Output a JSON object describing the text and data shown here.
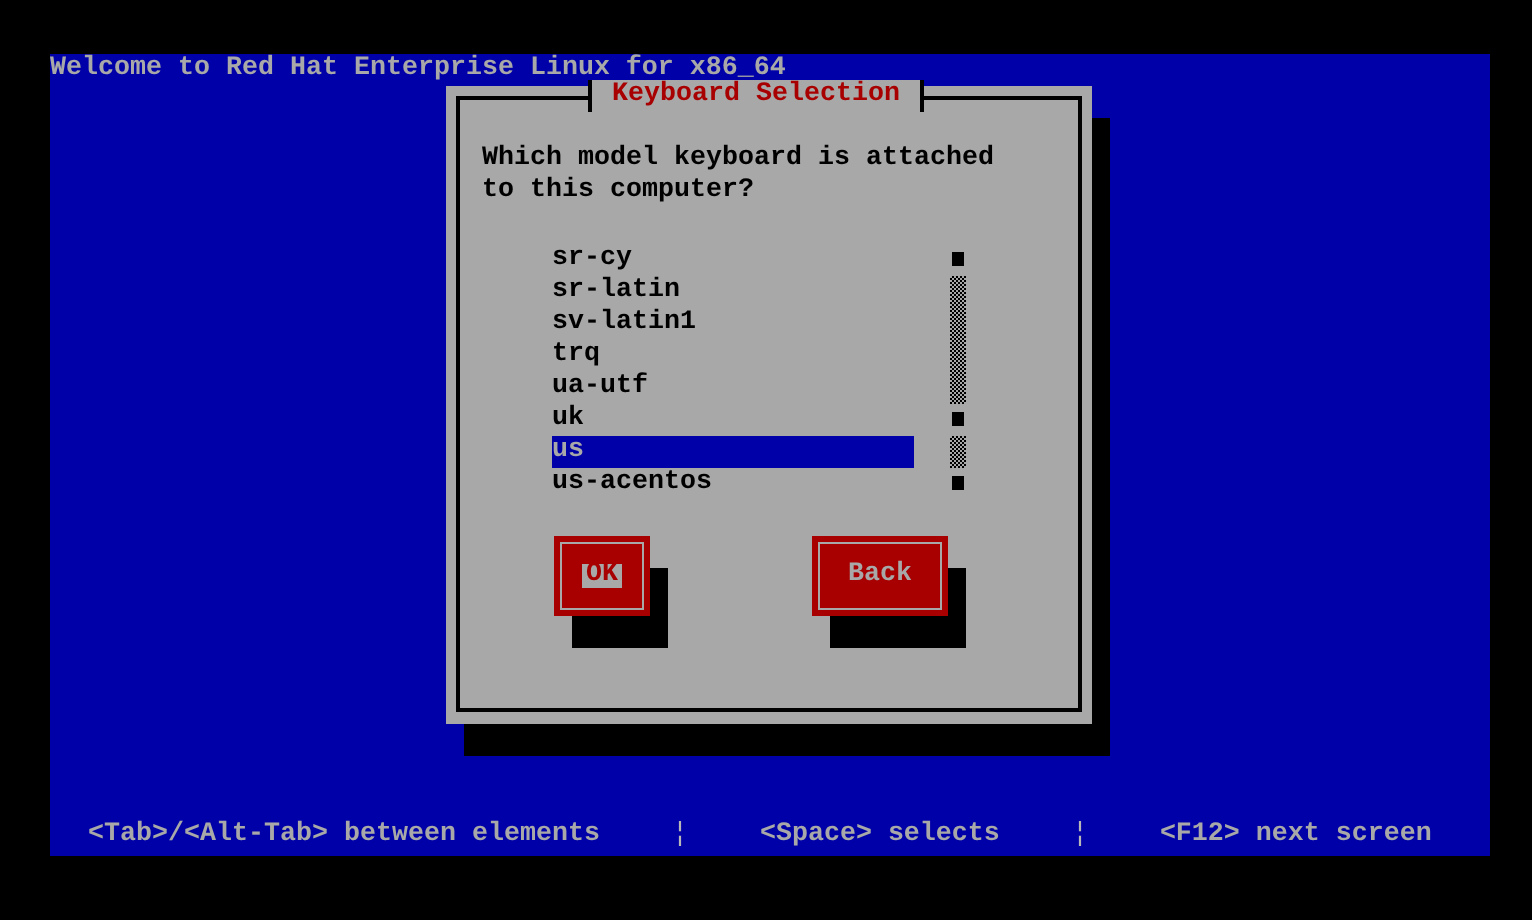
{
  "screen": {
    "title": "Welcome to Red Hat Enterprise Linux for x86_64"
  },
  "dialog": {
    "title": "Keyboard Selection",
    "prompt": "Which model keyboard is attached to this computer?",
    "items": [
      {
        "label": "sr-cy",
        "selected": false
      },
      {
        "label": "sr-latin",
        "selected": false
      },
      {
        "label": "sv-latin1",
        "selected": false
      },
      {
        "label": "trq",
        "selected": false
      },
      {
        "label": "ua-utf",
        "selected": false
      },
      {
        "label": "uk",
        "selected": false
      },
      {
        "label": "us",
        "selected": true
      },
      {
        "label": "us-acentos",
        "selected": false
      }
    ],
    "buttons": [
      {
        "label": "OK",
        "focused": true
      },
      {
        "label": "Back",
        "focused": false
      }
    ]
  },
  "status_bar": [
    {
      "kind": "hint",
      "text": "<Tab>/<Alt-Tab> between elements"
    },
    {
      "kind": "separator",
      "text": "¦"
    },
    {
      "kind": "hint",
      "text": "<Space> selects"
    },
    {
      "kind": "separator",
      "text": "¦"
    },
    {
      "kind": "hint",
      "text": "<F12> next screen"
    }
  ]
}
